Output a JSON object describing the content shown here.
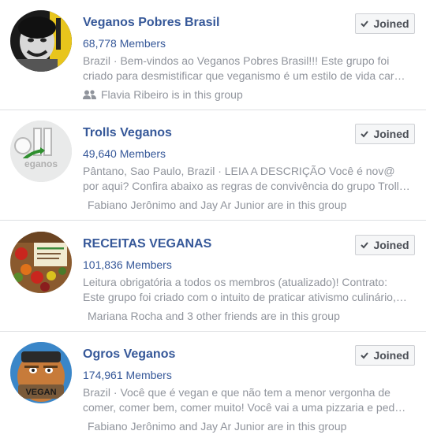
{
  "groups": [
    {
      "name": "Veganos Pobres Brasil",
      "members": "68,778 Members",
      "description": "Brazil · Bem-vindos ao Veganos Pobres Brasil!!! Este grupo foi criado para desmistificar que veganismo é um estilo de vida caro, e você, como vegano pobre, sabe muito bem disso.",
      "friends": "Flavia Ribeiro is in this group",
      "button": "Joined",
      "avatar_icon": "portrait-photo"
    },
    {
      "name": "Trolls Veganos",
      "members": "49,640 Members",
      "description": "Pântano, Sao Paulo, Brazil · LEIA A DESCRIÇÃO Você é nov@ por aqui? Confira abaixo as regras de convivência do grupo Trolls Veganos para participar.",
      "friends": "Fabiano Jerônimo and Jay Ar Junior are in this group",
      "button": "Joined",
      "avatar_icon": "trolls-logo"
    },
    {
      "name": "RECEITAS VEGANAS",
      "members": "101,836 Members",
      "description": "Leitura obrigatória a todos os membros (atualizado)! Contrato: Este grupo foi criado com o intuito de praticar ativismo culinário, ou seja, compartilhar receitas.",
      "friends": "Mariana Rocha and 3 other friends are in this group",
      "button": "Joined",
      "avatar_icon": "vegetables-photo"
    },
    {
      "name": "Ogros Veganos",
      "members": "174,961 Members",
      "description": "Brazil · Você que é vegan e que não tem a menor vergonha de comer, comer bem, comer muito! Você vai a uma pizzaria e pede uma pizza inteira só pra você.",
      "friends": "Fabiano Jerônimo and Jay Ar Junior are in this group",
      "button": "Joined",
      "avatar_icon": "ogre-cartoon"
    }
  ],
  "colors": {
    "link": "#365899",
    "meta": "#90949c",
    "divider": "#dddfe2",
    "button_bg": "#f5f6f7"
  }
}
